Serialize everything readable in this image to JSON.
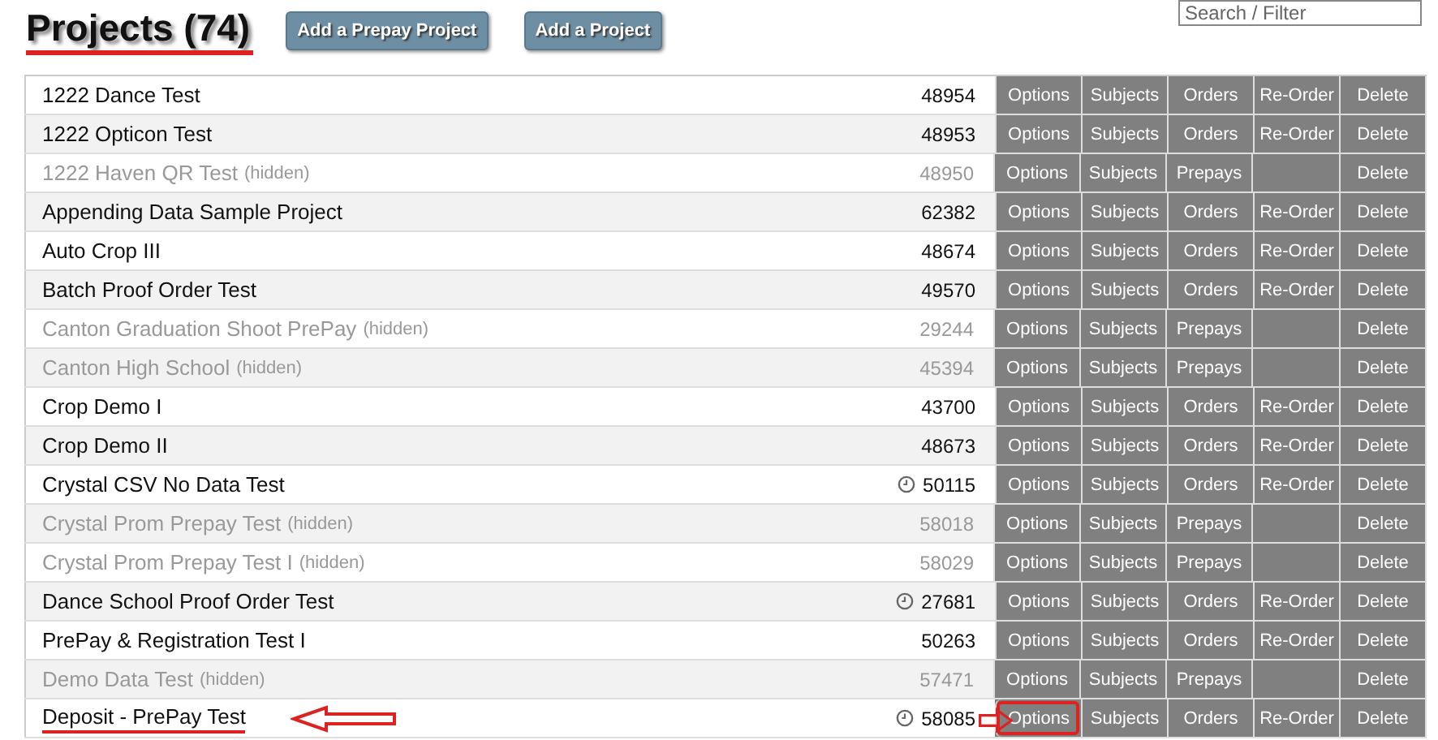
{
  "header": {
    "title": "Projects (74)",
    "underlined": true,
    "buttons": [
      "Add a Prepay Project",
      "Add a Project"
    ],
    "search": {
      "placeholder": "Search / Filter"
    }
  },
  "rows": [
    {
      "name": "1222 Dance Test",
      "hidden": false,
      "number": "48954",
      "clock": false,
      "actions": [
        "Options",
        "Subjects",
        "Orders",
        "Re-Order",
        "Delete"
      ]
    },
    {
      "name": "1222 Opticon Test",
      "hidden": false,
      "number": "48953",
      "clock": false,
      "actions": [
        "Options",
        "Subjects",
        "Orders",
        "Re-Order",
        "Delete"
      ]
    },
    {
      "name": "1222 Haven QR Test",
      "hidden": true,
      "hidden_label": "(hidden)",
      "number": "48950",
      "clock": false,
      "actions": [
        "Options",
        "Subjects",
        "Prepays",
        {
          "kind": "empty"
        },
        "Delete"
      ]
    },
    {
      "name": "Appending Data Sample Project",
      "hidden": false,
      "number": "62382",
      "clock": false,
      "actions": [
        "Options",
        "Subjects",
        "Orders",
        "Re-Order",
        "Delete"
      ]
    },
    {
      "name": "Auto Crop III",
      "hidden": false,
      "number": "48674",
      "clock": false,
      "actions": [
        "Options",
        "Subjects",
        "Orders",
        "Re-Order",
        "Delete"
      ]
    },
    {
      "name": "Batch Proof Order Test",
      "hidden": false,
      "number": "49570",
      "clock": false,
      "actions": [
        "Options",
        "Subjects",
        "Orders",
        "Re-Order",
        "Delete"
      ]
    },
    {
      "name": "Canton Graduation Shoot PrePay",
      "hidden": true,
      "hidden_label": "(hidden)",
      "number": "29244",
      "clock": false,
      "actions": [
        "Options",
        "Subjects",
        "Prepays",
        {
          "kind": "empty"
        },
        "Delete"
      ]
    },
    {
      "name": "Canton High School",
      "hidden": true,
      "hidden_label": "(hidden)",
      "number": "45394",
      "clock": false,
      "actions": [
        "Options",
        "Subjects",
        "Prepays",
        {
          "kind": "empty"
        },
        "Delete"
      ]
    },
    {
      "name": "Crop Demo I",
      "hidden": false,
      "number": "43700",
      "clock": false,
      "actions": [
        "Options",
        "Subjects",
        "Orders",
        "Re-Order",
        "Delete"
      ]
    },
    {
      "name": "Crop Demo II",
      "hidden": false,
      "number": "48673",
      "clock": false,
      "actions": [
        "Options",
        "Subjects",
        "Orders",
        "Re-Order",
        "Delete"
      ]
    },
    {
      "name": "Crystal CSV No Data Test",
      "hidden": false,
      "number": "50115",
      "clock": true,
      "actions": [
        "Options",
        "Subjects",
        "Orders",
        "Re-Order",
        "Delete"
      ]
    },
    {
      "name": "Crystal Prom Prepay Test",
      "hidden": true,
      "hidden_label": "(hidden)",
      "number": "58018",
      "clock": false,
      "actions": [
        "Options",
        "Subjects",
        "Prepays",
        {
          "kind": "empty"
        },
        "Delete"
      ]
    },
    {
      "name": "Crystal Prom Prepay Test I",
      "hidden": true,
      "hidden_label": "(hidden)",
      "number": "58029",
      "clock": false,
      "actions": [
        "Options",
        "Subjects",
        "Prepays",
        {
          "kind": "empty"
        },
        "Delete"
      ]
    },
    {
      "name": "Dance School Proof Order Test",
      "hidden": false,
      "number": "27681",
      "clock": true,
      "actions": [
        "Options",
        "Subjects",
        "Orders",
        "Re-Order",
        "Delete"
      ]
    },
    {
      "name": "PrePay & Registration Test I",
      "hidden": false,
      "number": "50263",
      "clock": false,
      "actions": [
        "Options",
        "Subjects",
        "Orders",
        "Re-Order",
        "Delete"
      ]
    },
    {
      "name": "Demo Data Test",
      "hidden": true,
      "hidden_label": "(hidden)",
      "number": "57471",
      "clock": false,
      "actions": [
        "Options",
        "Subjects",
        "Prepays",
        {
          "kind": "empty"
        },
        "Delete"
      ]
    },
    {
      "name": "Deposit - PrePay Test",
      "hidden": false,
      "number": "58085",
      "clock": true,
      "annotated": true,
      "actions": [
        "Options",
        "Subjects",
        "Orders",
        "Re-Order",
        "Delete"
      ]
    }
  ]
}
